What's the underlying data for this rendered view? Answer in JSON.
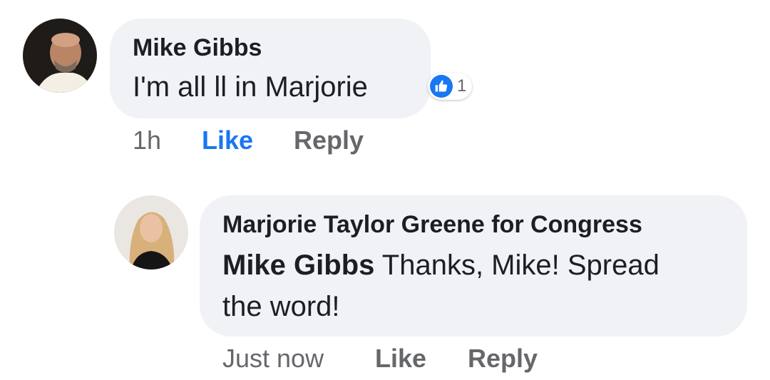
{
  "comment": {
    "author": "Mike Gibbs",
    "text": "I'm all ll in Marjorie",
    "reactions": {
      "icon": "thumbs-up-icon",
      "count": "1"
    },
    "time": "1h",
    "like_label": "Like",
    "reply_label": "Reply"
  },
  "reply": {
    "author": "Marjorie Taylor Greene for Congress",
    "mention": "Mike Gibbs",
    "text_line1": "Thanks, Mike! Spread",
    "text_line2": "the word!",
    "time": "Just now",
    "like_label": "Like",
    "reply_label": "Reply"
  },
  "colors": {
    "bubble": "#f0f2f5",
    "like_active": "#1877f2",
    "meta_gray": "#65676b",
    "text": "#1c1e21"
  }
}
